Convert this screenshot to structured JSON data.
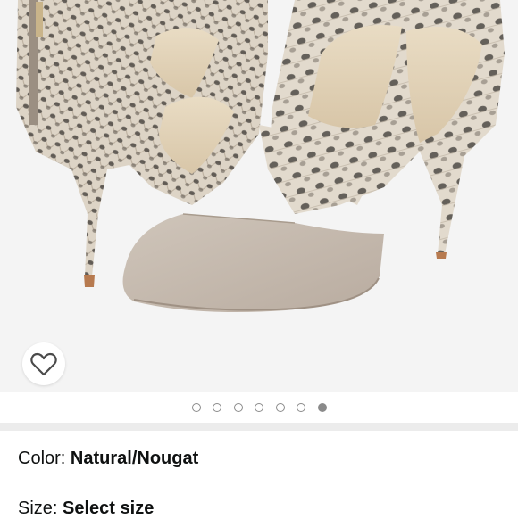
{
  "product": {
    "image_alt": "Snake-print and taupe suede pointed-toe cutout pumps",
    "wishlist_icon": "heart-outline-icon"
  },
  "gallery": {
    "total_images": 7,
    "active_index": 6
  },
  "attributes": {
    "color_label": "Color: ",
    "color_value": "Natural/Nougat",
    "size_label": "Size: ",
    "size_value": "Select size"
  },
  "colors": {
    "image_bg": "#f4f4f4",
    "divider": "#ececec",
    "dot": "#8a8a8a",
    "suede": "#c8bdb1",
    "snake_base": "#d9d0c2",
    "snake_scale": "#3e3a35"
  }
}
